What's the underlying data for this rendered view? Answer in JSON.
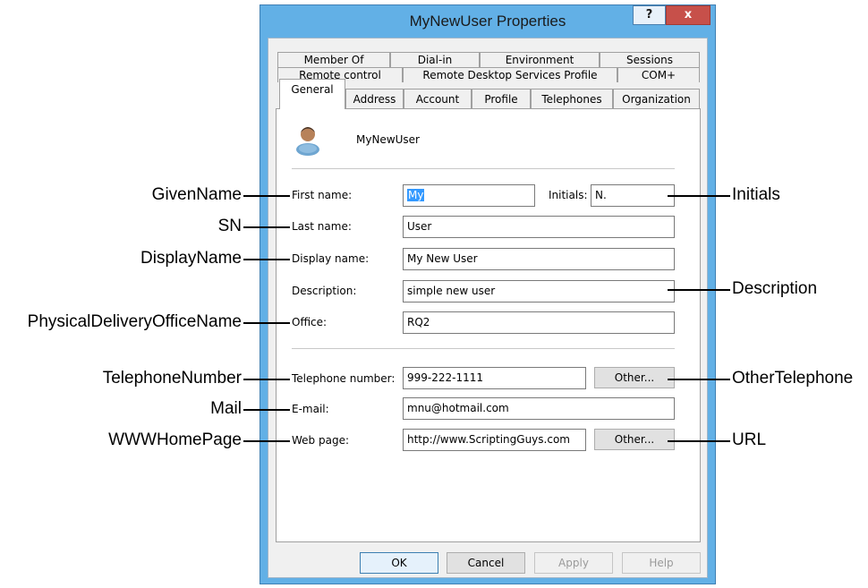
{
  "window": {
    "title": "MyNewUser Properties",
    "help_label": "?",
    "close_label": "x"
  },
  "tabs": {
    "row1": [
      "Member Of",
      "Dial-in",
      "Environment",
      "Sessions"
    ],
    "row2": [
      "Remote control",
      "Remote Desktop Services Profile",
      "COM+"
    ],
    "row3": [
      "General",
      "Address",
      "Account",
      "Profile",
      "Telephones",
      "Organization"
    ],
    "active": "General"
  },
  "general": {
    "user_name": "MyNewUser",
    "first_name_label": "First name:",
    "first_name_value": "My",
    "initials_label": "Initials:",
    "initials_value": "N.",
    "last_name_label": "Last name:",
    "last_name_value": "User",
    "display_name_label": "Display name:",
    "display_name_value": "My New User",
    "description_label": "Description:",
    "description_value": "simple new user",
    "office_label": "Office:",
    "office_value": "RQ2",
    "telephone_label": "Telephone number:",
    "telephone_value": "999-222-1111",
    "email_label": "E-mail:",
    "email_value": "mnu@hotmail.com",
    "webpage_label": "Web page:",
    "webpage_value": "http://www.ScriptingGuys.com",
    "other_phone_button": "Other...",
    "other_web_button": "Other..."
  },
  "footer": {
    "ok": "OK",
    "cancel": "Cancel",
    "apply": "Apply",
    "help": "Help"
  },
  "callouts": {
    "left": [
      "GivenName",
      "SN",
      "DisplayName",
      "PhysicalDeliveryOfficeName",
      "TelephoneNumber",
      "Mail",
      "WWWHomePage"
    ],
    "right": [
      "Initials",
      "Description",
      "OtherTelephone",
      "URL"
    ]
  }
}
